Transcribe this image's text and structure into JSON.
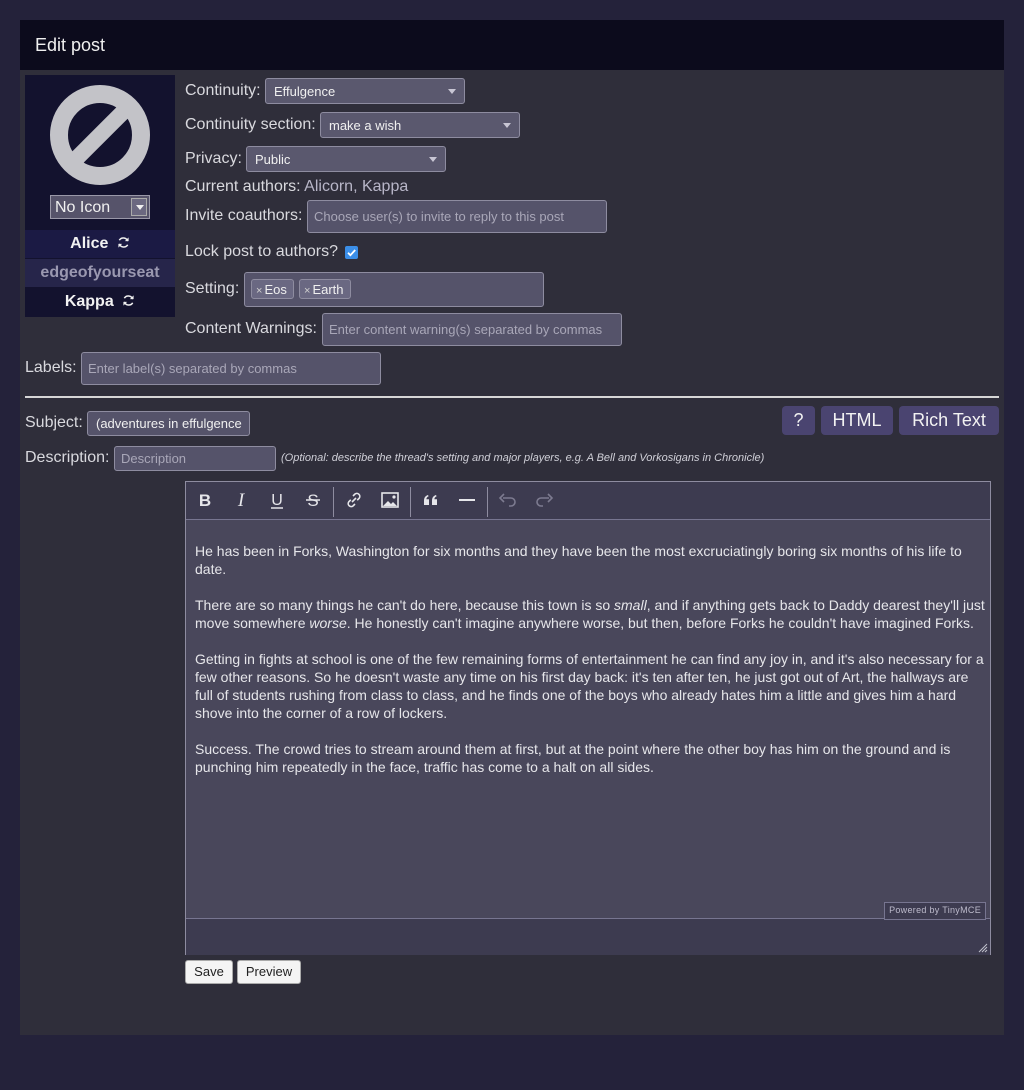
{
  "header": {
    "title": "Edit post"
  },
  "icon_panel": {
    "icon_select_value": "No Icon",
    "authors": [
      {
        "name": "Alice",
        "refresh": "refresh-icon"
      },
      {
        "name": "edgeofyourseat"
      },
      {
        "name": "Kappa",
        "refresh": "refresh-icon"
      }
    ]
  },
  "form": {
    "continuity_label": "Continuity:",
    "continuity_value": "Effulgence",
    "section_label": "Continuity section:",
    "section_value": "make a wish",
    "privacy_label": "Privacy:",
    "privacy_value": "Public",
    "current_authors_label": "Current authors:",
    "current_authors_value": "Alicorn, Kappa",
    "invite_label": "Invite coauthors:",
    "invite_placeholder": "Choose user(s) to invite to reply to this post",
    "lock_label": "Lock post to authors?",
    "lock_checked": true,
    "setting_label": "Setting:",
    "setting_tags": [
      "Eos",
      "Earth"
    ],
    "warnings_label": "Content Warnings:",
    "warnings_placeholder": "Enter content warning(s) separated by commas",
    "labels_label": "Labels:",
    "labels_placeholder": "Enter label(s) separated by commas",
    "subject_label": "Subject:",
    "subject_value": "(adventures in effulgence",
    "description_label": "Description:",
    "description_placeholder": "Description",
    "description_hint": "(Optional: describe the thread's setting and major players, e.g. A Bell and Vorkosigans in Chronicle)"
  },
  "editor_modes": {
    "help": "?",
    "html": "HTML",
    "rich": "Rich Text"
  },
  "toolbar": [
    "bold-icon",
    "italic-icon",
    "underline-icon",
    "strikethrough-icon",
    "link-icon",
    "image-icon",
    "blockquote-icon",
    "horizontal-rule-icon",
    "undo-icon",
    "redo-icon"
  ],
  "editor": {
    "paragraphs": [
      "He has been in Forks, Washington for six months and they have been the most excruciatingly boring six months of his life to date.",
      "Getting in fights at school is one of the few remaining forms of entertainment he can find any joy in, and it's also necessary for a few other reasons. So he doesn't waste any time on his first day back: it's ten after ten, he just got out of Art, the hallways are full of students rushing from class to class, and he finds one of the boys who already hates him a little and gives him a hard shove into the corner of a row of lockers.",
      "Success. The crowd tries to stream around them at first, but at the point where the other boy has him on the ground and is punching him repeatedly in the face, traffic has come to a halt on all sides."
    ],
    "p2": {
      "a": "There are so many things he can't do here, because this town is so ",
      "em1": "small",
      "b": ", and if anything gets back to Daddy dearest they'll just move somewhere ",
      "em2": "worse",
      "c": ". He honestly can't imagine anywhere worse, but then, before Forks he couldn't have imagined Forks."
    },
    "powered_by": "Powered by TinyMCE"
  },
  "actions": {
    "save": "Save",
    "preview": "Preview"
  }
}
